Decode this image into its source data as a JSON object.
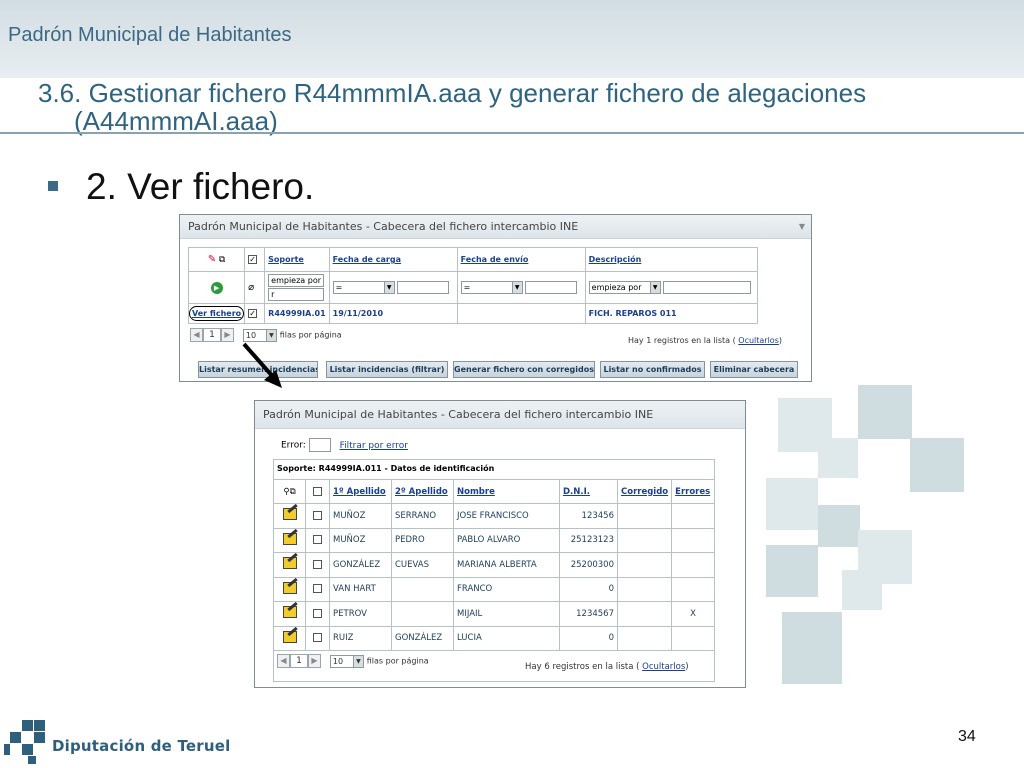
{
  "slide": {
    "app_title": "Padrón Municipal de Habitantes",
    "section_title_line1": "3.6. Gestionar fichero R44mmmIA.aaa y generar fichero de alegaciones",
    "section_title_line2": "(A44mmmAI.aaa)",
    "bullet": "2. Ver fichero.",
    "page_number": "34",
    "footer_org": "Diputación de Teruel"
  },
  "window1": {
    "title": "Padrón Municipal de Habitantes - Cabecera del fichero intercambio INE",
    "columns": {
      "soporte": "Soporte",
      "fecha_carga": "Fecha de carga",
      "fecha_envio": "Fecha de envío",
      "descripcion": "Descripción"
    },
    "filters": {
      "soporte_mode": "empieza por",
      "soporte_value": "r",
      "fecha_carga_op": "=",
      "fecha_envio_op": "=",
      "descripcion_mode": "empieza por"
    },
    "row": {
      "link": "Ver fichero",
      "soporte": "R44999IA.01",
      "fecha_carga": "19/11/2010",
      "descripcion": "FICH. REPAROS 011"
    },
    "pager": {
      "page": "1",
      "rows": "10",
      "rows_label": "filas por página"
    },
    "info_text": "Hay 1 registros en la lista (",
    "info_link": "Ocultarlos",
    "info_end": ")",
    "buttons": [
      "Listar resumen incidencias",
      "Listar incidencias (filtrar)",
      "Generar fichero con corregidos",
      "Listar no confirmados",
      "Eliminar cabecera"
    ]
  },
  "window2": {
    "title": "Padrón Municipal de Habitantes - Cabecera del fichero intercambio INE",
    "error_label": "Error:",
    "filter_link": "Filtrar por error",
    "group_title": "Soporte: R44999IA.011 - Datos de identificación",
    "headers": {
      "ap1": "1º Apellido",
      "ap2": "2º Apellido",
      "nombre": "Nombre",
      "dni": "D.N.I.",
      "corregido": "Corregido",
      "errores": "Errores"
    },
    "rows": [
      {
        "ap1": "MUÑOZ",
        "ap2": "SERRANO",
        "nombre": "JOSE FRANCISCO",
        "dni": "123456",
        "corregido": "",
        "errores": ""
      },
      {
        "ap1": "MUÑOZ",
        "ap2": "PEDRO",
        "nombre": "PABLO ALVARO",
        "dni": "25123123",
        "corregido": "",
        "errores": ""
      },
      {
        "ap1": "GONZÁLEZ",
        "ap2": "CUEVAS",
        "nombre": "MARIANA ALBERTA",
        "dni": "25200300",
        "corregido": "",
        "errores": ""
      },
      {
        "ap1": "VAN HART",
        "ap2": "",
        "nombre": "FRANCO",
        "dni": "0",
        "corregido": "",
        "errores": ""
      },
      {
        "ap1": "PETROV",
        "ap2": "",
        "nombre": "MIJAIL",
        "dni": "1234567",
        "corregido": "",
        "errores": "X"
      },
      {
        "ap1": "RUIZ",
        "ap2": "GONZÁLEZ",
        "nombre": "LUCIA",
        "dni": "0",
        "corregido": "",
        "errores": ""
      }
    ],
    "pager": {
      "page": "1",
      "rows": "10",
      "rows_label": "filas por página"
    },
    "info_text": "Hay 6 registros en la lista (",
    "info_link": "Ocultarlos",
    "info_end": ")"
  },
  "colors": {
    "brand": "#2e5f7c",
    "title": "#2f6480",
    "link": "#1b3f8f"
  }
}
